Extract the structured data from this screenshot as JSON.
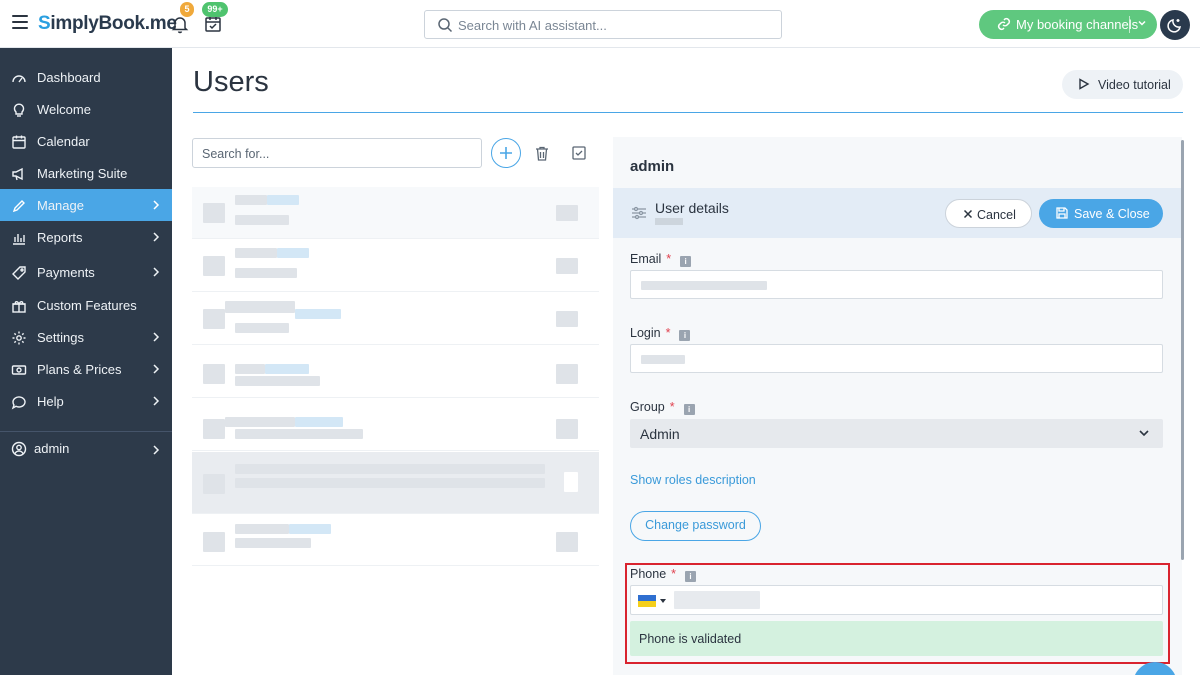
{
  "header": {
    "logo_prefix": "S",
    "logo_text": "implyBook.me",
    "notifications_count": "5",
    "calendar_count": "99+",
    "search_placeholder": "Search with AI assistant...",
    "booking_channels_label": "My booking channels"
  },
  "sidebar": {
    "items": [
      {
        "label": "Dashboard",
        "icon": "gauge-icon"
      },
      {
        "label": "Welcome",
        "icon": "lightbulb-icon"
      },
      {
        "label": "Calendar",
        "icon": "calendar-icon"
      },
      {
        "label": "Marketing Suite",
        "icon": "megaphone-icon"
      },
      {
        "label": "Manage",
        "icon": "pencil-icon",
        "active": true
      },
      {
        "label": "Reports",
        "icon": "bar-chart-icon"
      },
      {
        "label": "Payments",
        "icon": "tag-icon"
      },
      {
        "label": "Custom Features",
        "icon": "gift-icon"
      },
      {
        "label": "Settings",
        "icon": "gear-icon"
      },
      {
        "label": "Plans & Prices",
        "icon": "money-icon"
      },
      {
        "label": "Help",
        "icon": "chat-icon"
      }
    ],
    "account_label": "admin",
    "active_color": "#4aa6e6",
    "background_color": "#2d3a4a"
  },
  "main": {
    "page_title": "Users",
    "video_tutorial_label": "Video tutorial",
    "list_search_placeholder": "Search for..."
  },
  "details": {
    "title": "admin",
    "section_label": "User details",
    "cancel_label": "Cancel",
    "save_label": "Save & Close",
    "email_label": "Email",
    "login_label": "Login",
    "group_label": "Group",
    "group_value": "Admin",
    "required_mark": "*",
    "info_mark": "i",
    "roles_link": "Show roles description",
    "change_password_label": "Change password",
    "phone_label": "Phone",
    "phone_status": "Phone is validated"
  },
  "colors": {
    "accent": "#4aa6e6",
    "booking_button": "#5fc87f",
    "success_background": "#d4f1df",
    "highlight_border": "#d9242f",
    "required": "#e0414e"
  }
}
